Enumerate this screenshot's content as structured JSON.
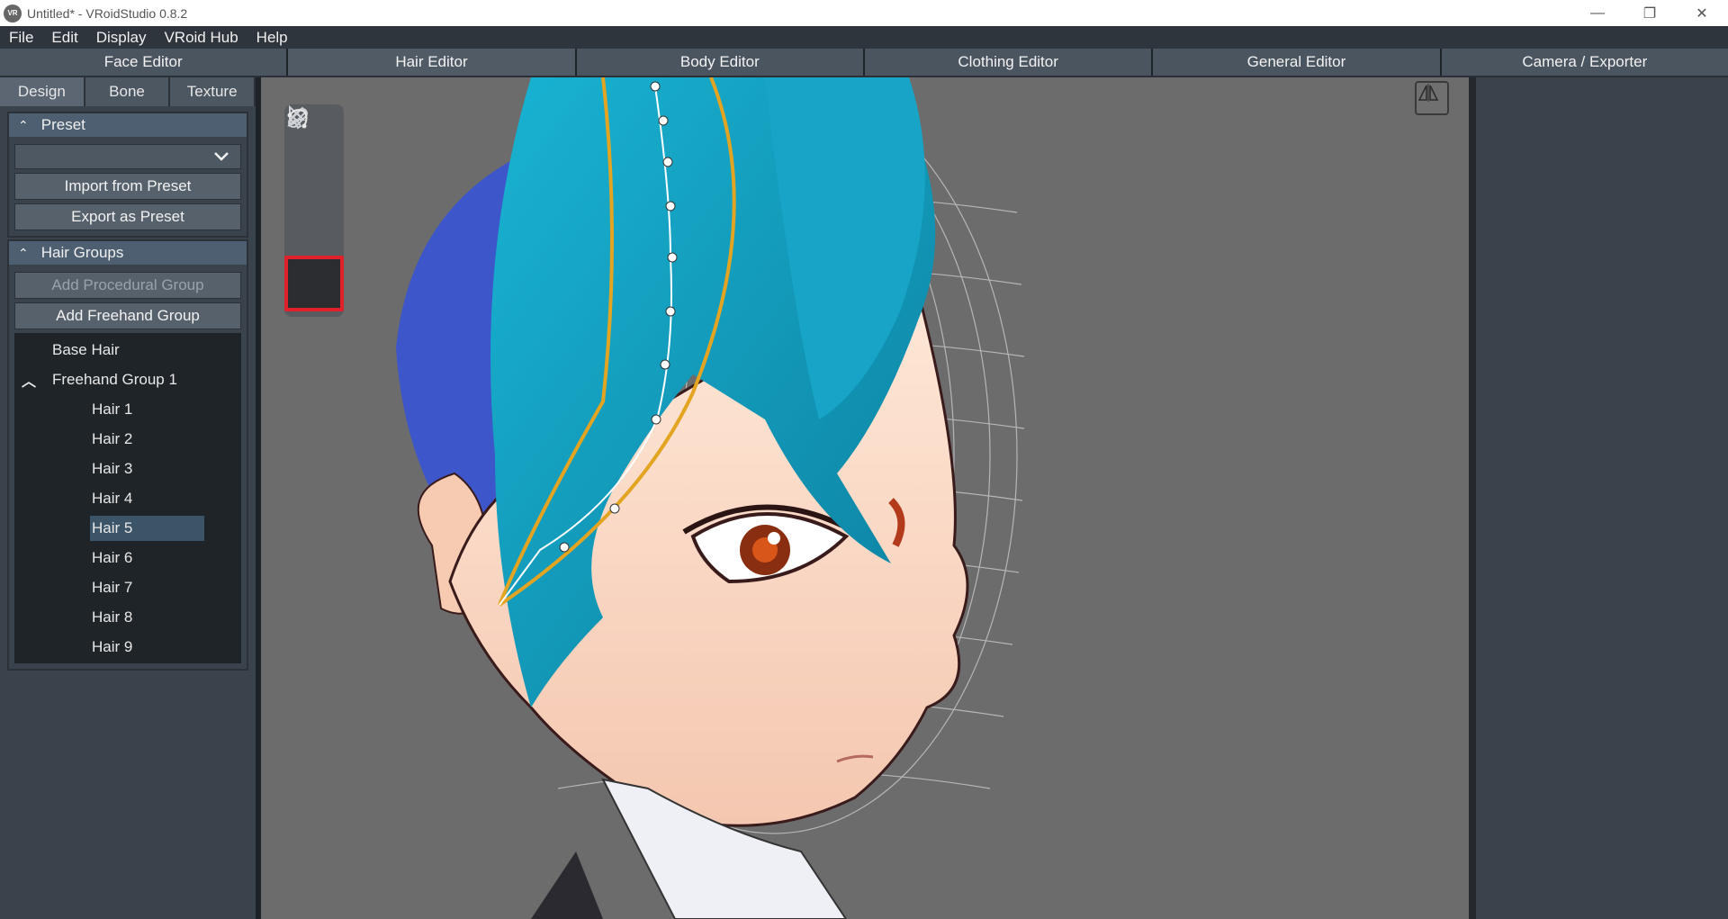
{
  "window": {
    "title": "Untitled* - VRoidStudio 0.8.2",
    "app_icon_text": "VR",
    "controls": {
      "minimize": "—",
      "restore": "❐",
      "close": "✕"
    }
  },
  "menu": [
    "File",
    "Edit",
    "Display",
    "VRoid Hub",
    "Help"
  ],
  "editor_tabs": [
    {
      "label": "Face Editor"
    },
    {
      "label": "Hair Editor",
      "active": true
    },
    {
      "label": "Body Editor"
    },
    {
      "label": "Clothing Editor"
    },
    {
      "label": "General Editor"
    },
    {
      "label": "Camera / Exporter"
    }
  ],
  "sub_tabs": [
    {
      "label": "Design",
      "active": true
    },
    {
      "label": "Bone"
    },
    {
      "label": "Texture"
    }
  ],
  "preset_section": {
    "header": "Preset",
    "dropdown_value": "",
    "import_label": "Import from Preset",
    "export_label": "Export as Preset"
  },
  "hair_groups_section": {
    "header": "Hair Groups",
    "add_procedural_label": "Add Procedural Group",
    "add_freehand_label": "Add Freehand Group",
    "base_hair": "Base Hair",
    "group_name": "Freehand Group 1",
    "hairs": [
      "Hair 1",
      "Hair 2",
      "Hair 3",
      "Hair 4",
      "Hair 5",
      "Hair 6",
      "Hair 7",
      "Hair 8",
      "Hair 9"
    ],
    "selected": "Hair 5"
  },
  "tools": [
    "select-tool",
    "pen-tool",
    "eraser-tool",
    "curve-edit-tool"
  ],
  "colors": {
    "hair": "#1aa6c8",
    "guide_line": "#e3a422",
    "highlight_box": "#e0202a",
    "viewport_bg": "#6c6c6c"
  }
}
